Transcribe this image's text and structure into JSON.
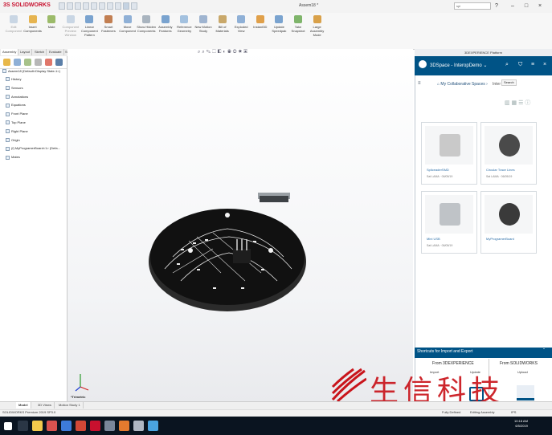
{
  "app": {
    "name": "SOLIDWORKS",
    "logo_prefix": "3S",
    "window_title": "Assem18 *",
    "search_placeholder": "spl"
  },
  "ribbon": {
    "buttons": [
      {
        "label": "Edit Component",
        "dim": true
      },
      {
        "label": "Insert Components",
        "dim": false
      },
      {
        "label": "Mate",
        "dim": false
      },
      {
        "label": "Component Preview Window",
        "dim": true
      },
      {
        "label": "Linear Component Pattern",
        "dim": false
      },
      {
        "label": "Smart Fasteners",
        "dim": false
      },
      {
        "label": "Move Component",
        "dim": false
      },
      {
        "label": "Show Hidden Components",
        "dim": false
      },
      {
        "label": "Assembly Features",
        "dim": false
      },
      {
        "label": "Reference Geometry",
        "dim": false
      },
      {
        "label": "New Motion Study",
        "dim": false
      },
      {
        "label": "Bill of Materials",
        "dim": false
      },
      {
        "label": "Exploded View",
        "dim": false
      },
      {
        "label": "Instant3D",
        "dim": false
      },
      {
        "label": "Update Speedpak",
        "dim": false
      },
      {
        "label": "Take Snapshot",
        "dim": false
      },
      {
        "label": "Large Assembly Mode",
        "dim": false
      }
    ]
  },
  "command_tabs": [
    "Assembly",
    "Layout",
    "Sketch",
    "Evaluate",
    "SOLIDWORKS Add-Ins",
    "MBD"
  ],
  "feature_tree": {
    "root": "Assem18  (Default<Display State-1>)",
    "items": [
      "History",
      "Sensors",
      "Annotations",
      "Equations",
      "Front Plane",
      "Top Plane",
      "Right Plane",
      "Origin",
      "(f) MyProgramerBoard<1> (Defa...",
      "Mates"
    ]
  },
  "viewport": {
    "view_label": "*Trimetric"
  },
  "platform_panel": {
    "title": "3DEXPERIENCE Platform",
    "space": "3DSpace - InteropDemo",
    "search_tooltip": "Search",
    "collab_spaces": "My Collaborative Spaces",
    "collab_sub": "Inter",
    "cards": [
      {
        "name": "SpliceaderSMD",
        "meta": "Sat LAMA  ·  06/05/19"
      },
      {
        "name": "Circular Trace Lines",
        "meta": "Sat LAMA  ·  06/05/19"
      },
      {
        "name": "Mini USB",
        "meta": "Sat LAMA  ·  06/05/19"
      },
      {
        "name": "MyProgramerBoard",
        "meta": ""
      }
    ],
    "shortcuts_title": "Shortcuts for Import and Export",
    "from_3dx": "From 3DEXPERIENCE",
    "from_sw": "From SOLIDWORKS",
    "import_label": "Import",
    "update_label": "Update",
    "upload_label": "Upload"
  },
  "bottom_tabs": [
    "Model",
    "3D Views",
    "Motion Study 1"
  ],
  "status": {
    "left": "SOLIDWORKS Premium 2019 SP3.0",
    "fully_defined": "Fully Defined",
    "editing": "Editing Assembly",
    "units": "IPS"
  },
  "taskbar": {
    "time": "10:18 AM",
    "date": "6/5/2019"
  },
  "watermark": "生信科技",
  "colors": {
    "brand_red": "#c8102e",
    "platform_blue": "#005386",
    "board": "#141414",
    "watermark_red": "#c9141b"
  }
}
